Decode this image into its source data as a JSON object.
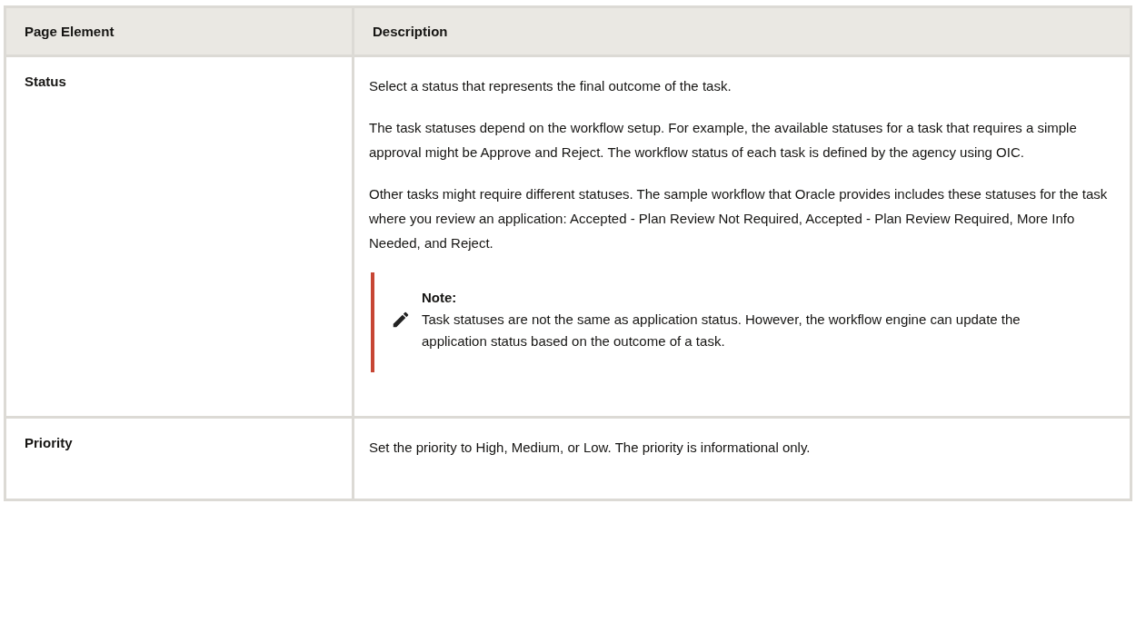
{
  "table": {
    "columns": [
      "Page Element",
      "Description"
    ],
    "rows": [
      {
        "element": "Status",
        "description": [
          {
            "kind": "paragraph",
            "text": "Select a status that represents the final outcome of the task."
          },
          {
            "kind": "paragraph",
            "text": "The task statuses depend on the workflow setup. For example, the available statuses for a task that requires a simple approval might be Approve and Reject. The workflow status of each task is defined by the agency using OIC."
          },
          {
            "kind": "paragraph",
            "text": "Other tasks might require different statuses. The sample workflow that Oracle provides includes these statuses for the task where you review an application: Accepted - Plan Review Not Required, Accepted - Plan Review Required, More Info Needed, and Reject."
          },
          {
            "kind": "note",
            "title": "Note:",
            "text": "Task statuses are not the same as application status. However, the workflow engine can update the application status based on the outcome of a task."
          }
        ]
      },
      {
        "element": "Priority",
        "description": [
          {
            "kind": "paragraph",
            "text": "Set the priority to High, Medium, or Low. The priority is informational only."
          }
        ]
      }
    ]
  }
}
